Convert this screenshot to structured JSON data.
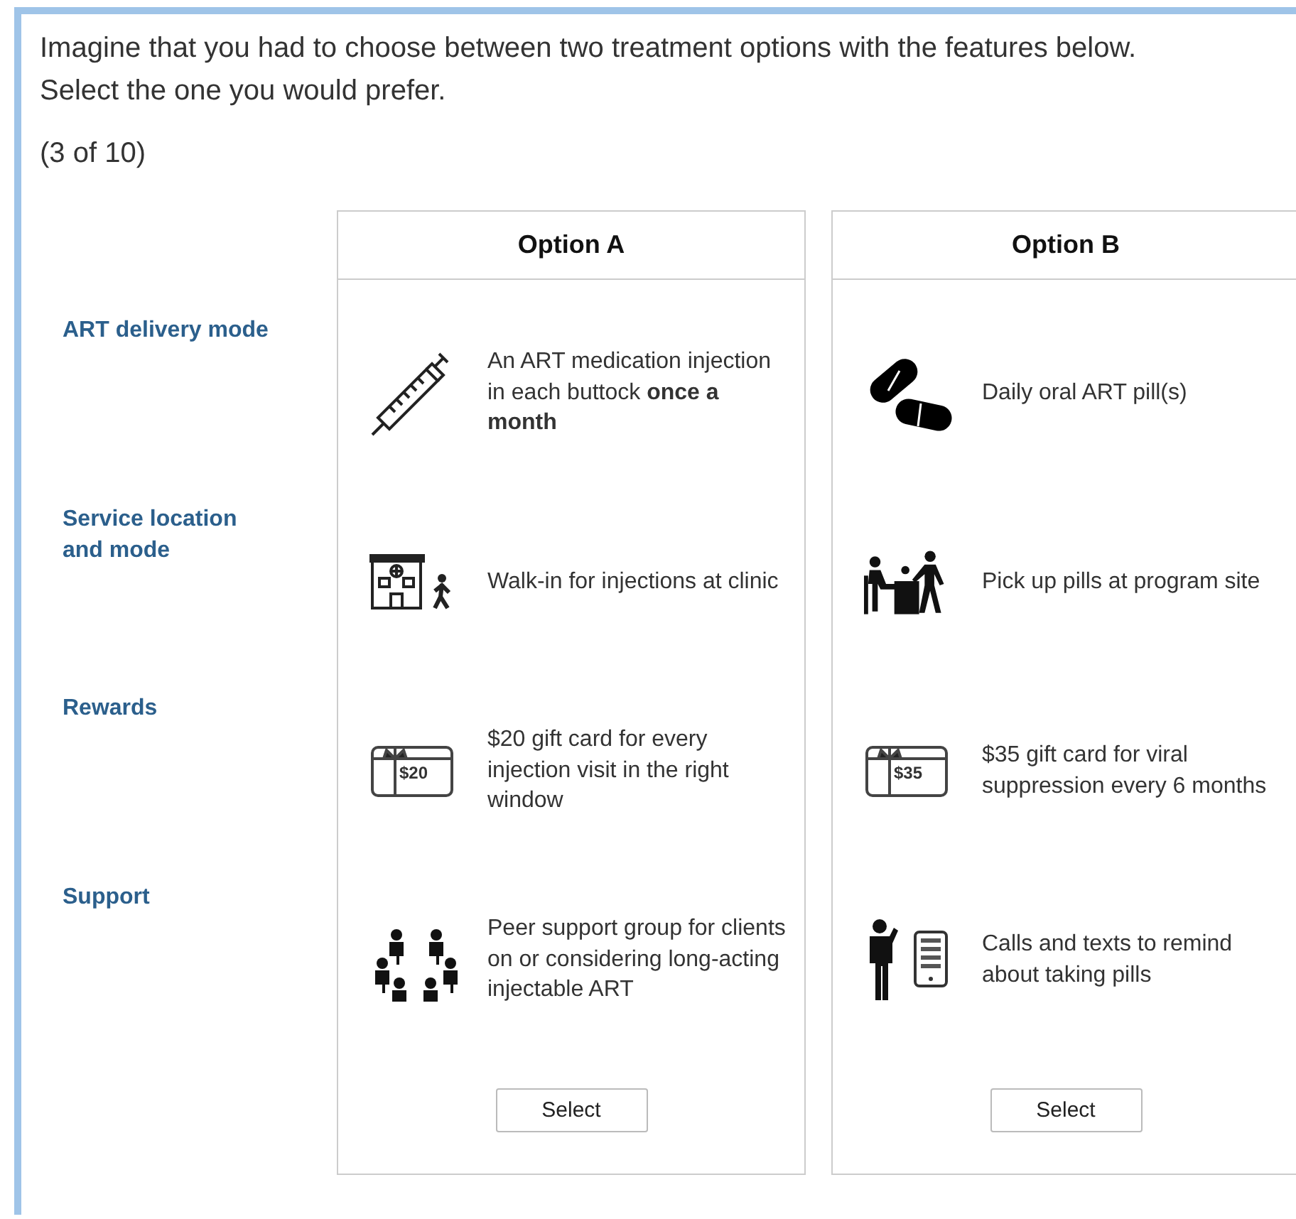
{
  "question": "Imagine that you had to choose between two treatment options with the features below. Select the one you would prefer.",
  "progress": "(3 of 10)",
  "attributes": [
    "ART delivery mode",
    "Service location and mode",
    "Rewards",
    "Support"
  ],
  "options": [
    {
      "title": "Option A",
      "features": [
        {
          "text": "An ART medication injection in each buttock **once a month**"
        },
        {
          "text": "Walk-in for injections at clinic"
        },
        {
          "text": "$20 gift card for every injection visit in the right window",
          "card_label": "$20"
        },
        {
          "text": "Peer support group for clients on or considering long-acting injectable ART"
        }
      ],
      "button": "Select"
    },
    {
      "title": "Option B",
      "features": [
        {
          "text": "Daily oral ART pill(s)"
        },
        {
          "text": "Pick up pills at program site"
        },
        {
          "text": "$35 gift card for viral suppression every 6 months",
          "card_label": "$35"
        },
        {
          "text": "Calls and texts to remind about taking pills"
        }
      ],
      "button": "Select"
    }
  ]
}
